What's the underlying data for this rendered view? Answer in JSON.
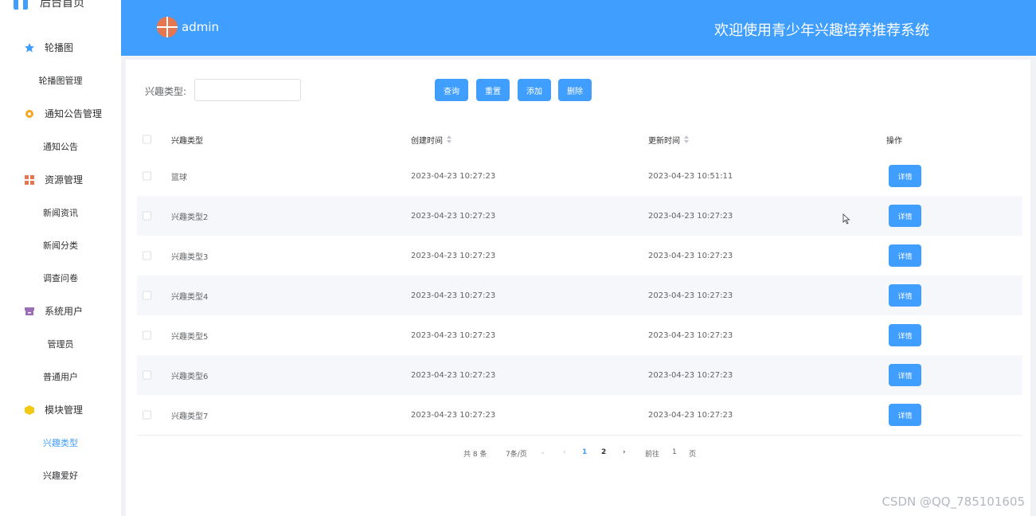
{
  "sidebar": {
    "home_label": "后台首页",
    "groups": [
      {
        "label": "轮播图",
        "icon": "star-icon",
        "color": "#409eff",
        "items": [
          "轮播图管理"
        ]
      },
      {
        "label": "通知公告管理",
        "icon": "gear-icon",
        "color": "#f5a623",
        "items": [
          "通知公告"
        ]
      },
      {
        "label": "资源管理",
        "icon": "grid-icon",
        "color": "#e6764f",
        "items": [
          "新闻资讯",
          "新闻分类",
          "调查问卷"
        ]
      },
      {
        "label": "系统用户",
        "icon": "box-icon",
        "color": "#9b6fb5",
        "items": [
          "管理员",
          "普通用户"
        ]
      },
      {
        "label": "模块管理",
        "icon": "cube-icon",
        "color": "#f2c811",
        "items": [
          "兴趣类型",
          "兴趣爱好"
        ]
      }
    ],
    "active_item": "兴趣类型"
  },
  "header": {
    "username": "admin",
    "title": "欢迎使用青少年兴趣培养推荐系统",
    "bg_color": "#409eff"
  },
  "search": {
    "label": "兴趣类型:",
    "value": "",
    "placeholder": ""
  },
  "toolbar": {
    "query": "查询",
    "reset": "重置",
    "add": "添加",
    "delete": "删除"
  },
  "table": {
    "headers": {
      "type": "兴趣类型",
      "created": "创建时间",
      "updated": "更新时间",
      "ops": "操作"
    },
    "detail_label": "详情",
    "rows": [
      {
        "type": "篮球",
        "created": "2023-04-23 10:27:23",
        "updated": "2023-04-23 10:51:11"
      },
      {
        "type": "兴趣类型2",
        "created": "2023-04-23 10:27:23",
        "updated": "2023-04-23 10:27:23"
      },
      {
        "type": "兴趣类型3",
        "created": "2023-04-23 10:27:23",
        "updated": "2023-04-23 10:27:23"
      },
      {
        "type": "兴趣类型4",
        "created": "2023-04-23 10:27:23",
        "updated": "2023-04-23 10:27:23"
      },
      {
        "type": "兴趣类型5",
        "created": "2023-04-23 10:27:23",
        "updated": "2023-04-23 10:27:23"
      },
      {
        "type": "兴趣类型6",
        "created": "2023-04-23 10:27:23",
        "updated": "2023-04-23 10:27:23"
      },
      {
        "type": "兴趣类型7",
        "created": "2023-04-23 10:27:23",
        "updated": "2023-04-23 10:27:23"
      }
    ]
  },
  "pagination": {
    "total": "共 8 条",
    "page_size": "7条/页",
    "pages": [
      "1",
      "2"
    ],
    "current": "1",
    "goto_prefix": "前往",
    "goto_value": "1",
    "goto_suffix": "页"
  },
  "watermark": "CSDN @QQ_785101605"
}
